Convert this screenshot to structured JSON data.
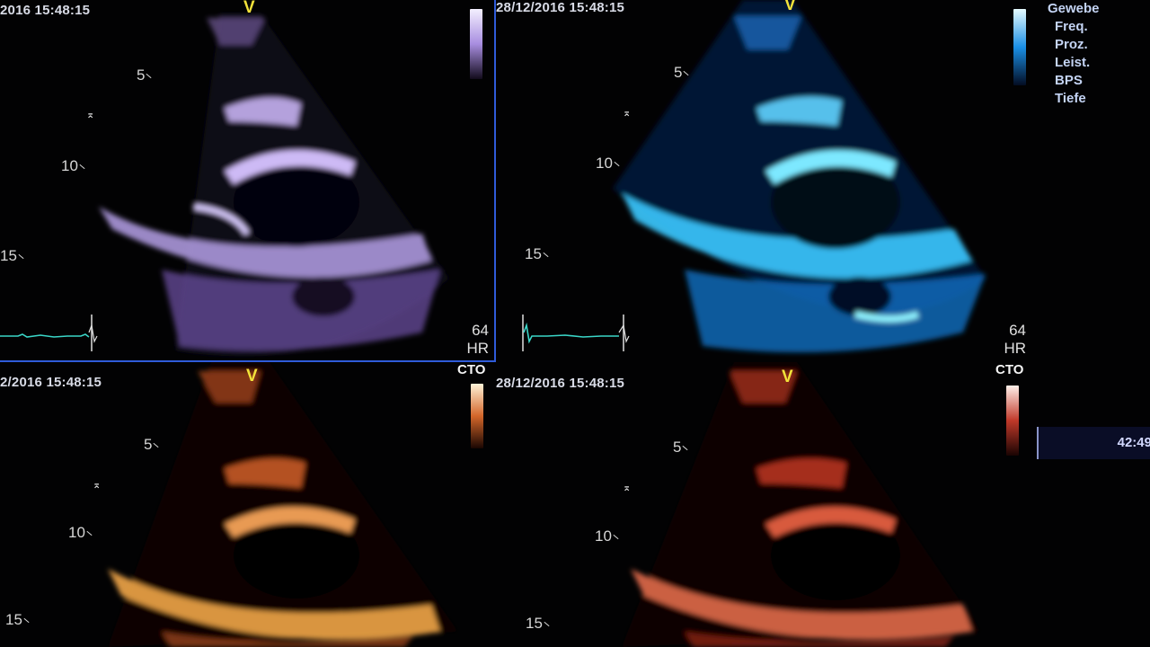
{
  "panels": [
    {
      "timestamp": "2016 15:48:15",
      "v_marker": "V",
      "depth_labels": [
        "5",
        "10",
        "15"
      ],
      "focus_marker": "⌅",
      "hr_value": "64",
      "hr_label": "HR",
      "palette": "violet"
    },
    {
      "timestamp": "28/12/2016 15:48:15",
      "v_marker": "V",
      "depth_labels": [
        "5",
        "10",
        "15"
      ],
      "focus_marker": "⌅",
      "hr_value": "64",
      "hr_label": "HR",
      "palette": "blue"
    },
    {
      "timestamp": "2/2016 15:48:15",
      "v_marker": "V",
      "depth_labels": [
        "5",
        "10",
        "15"
      ],
      "focus_marker": "⌅",
      "map_label": "CTO",
      "palette": "amber"
    },
    {
      "timestamp": "28/12/2016 15:48:15",
      "v_marker": "V",
      "depth_labels": [
        "5",
        "10",
        "15"
      ],
      "focus_marker": "⌅",
      "map_label": "CTO",
      "palette": "copper"
    }
  ],
  "parameter_menu": [
    "Gewebe",
    "Freq.",
    "Proz.",
    "Leist.",
    "BPS",
    "Tiefe"
  ],
  "clock": "42:49",
  "colors": {
    "violet_map": [
      "#1a1222",
      "#6f52a8",
      "#d9ccff"
    ],
    "blue_map": [
      "#03122e",
      "#0c76c9",
      "#8ff3ff"
    ],
    "amber_map": [
      "#1c0804",
      "#c0561f",
      "#ffd27a"
    ],
    "copper_map": [
      "#1a0503",
      "#b1321a",
      "#ffd4c4"
    ],
    "selection_border": "#2f5bd9",
    "v_marker": "#f2e23a",
    "ecg_trace": "#3ad6c8"
  }
}
